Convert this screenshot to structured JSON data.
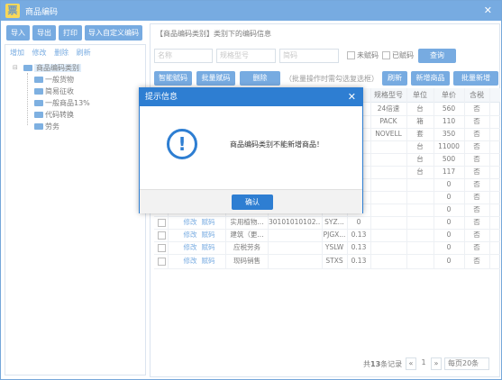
{
  "window": {
    "title": "商品编码",
    "icon_char": "票",
    "close_glyph": "✕"
  },
  "toolbar": {
    "import": "导入",
    "export": "导出",
    "print": "打印",
    "import_custom": "导入自定义编码"
  },
  "left": {
    "actions": {
      "add": "增加",
      "edit": "修改",
      "delete": "删除",
      "refresh": "刷新"
    },
    "tree": {
      "root": "商品编码类别",
      "children": [
        "一般货物",
        "简易征收",
        "一般商品13%",
        "代码转换",
        "劳务"
      ]
    }
  },
  "right": {
    "heading": "【商品编码类别】类别下的编码信息",
    "filters": {
      "name_placeholder": "名称",
      "spec_placeholder": "规格型号",
      "abbr_placeholder": "简码"
    },
    "checks": {
      "unassigned": "未赋码",
      "assigned": "已赋码"
    },
    "query": "查询",
    "buttons": {
      "smart": "智能赋码",
      "batch": "批量赋码",
      "delete": "删除",
      "hint": "（批量操作时需勾选复选框）",
      "refresh": "刷新",
      "add_product": "新增商品",
      "batch_add": "批量新增"
    },
    "columns": {
      "spec": "规格型号",
      "unit": "单位",
      "price": "单价",
      "tax_included": "含税"
    },
    "rows_top": [
      {
        "spec": "24倍速",
        "unit": "台",
        "price": "560",
        "tax": "否"
      },
      {
        "spec": "PACK",
        "unit": "箱",
        "price": "110",
        "tax": "否"
      },
      {
        "spec": "NOVELL",
        "unit": "套",
        "price": "350",
        "tax": "否"
      },
      {
        "spec": "",
        "unit": "台",
        "price": "11000",
        "tax": "否"
      },
      {
        "spec": "",
        "unit": "台",
        "price": "500",
        "tax": "否"
      },
      {
        "spec": "",
        "unit": "台",
        "price": "117",
        "tax": "否"
      },
      {
        "spec": "",
        "unit": "",
        "price": "0",
        "tax": "否"
      },
      {
        "spec": "",
        "unit": "",
        "price": "0",
        "tax": "否"
      },
      {
        "spec": "",
        "unit": "",
        "price": "0",
        "tax": "否"
      }
    ],
    "rows_bottom": [
      {
        "edit": "修改",
        "code": "赋码",
        "name": "实用植物...",
        "tax_code": "30101010102...",
        "abbr": "SYZ...",
        "rate": "0",
        "price": "0",
        "tax": "否"
      },
      {
        "edit": "修改",
        "code": "赋码",
        "name": "建筑（更...",
        "tax_code": "",
        "abbr": "PJGX...",
        "rate": "0.13",
        "price": "0",
        "tax": "否"
      },
      {
        "edit": "修改",
        "code": "赋码",
        "name": "应税劳务",
        "tax_code": "",
        "abbr": "YSLW",
        "rate": "0.13",
        "price": "0",
        "tax": "否"
      },
      {
        "edit": "修改",
        "code": "赋码",
        "name": "现码销售",
        "tax_code": "",
        "abbr": "STXS",
        "rate": "0.13",
        "price": "0",
        "tax": "否"
      }
    ],
    "pager": {
      "total_prefix": "共",
      "total": "13",
      "total_suffix": "条记录",
      "prev": "«",
      "page": "1",
      "next": "»",
      "page_size": "每页20条"
    }
  },
  "dialog": {
    "title": "提示信息",
    "close_glyph": "✕",
    "icon_char": "!",
    "message": "商品编码类别不能新增商品！",
    "ok": "确认"
  }
}
